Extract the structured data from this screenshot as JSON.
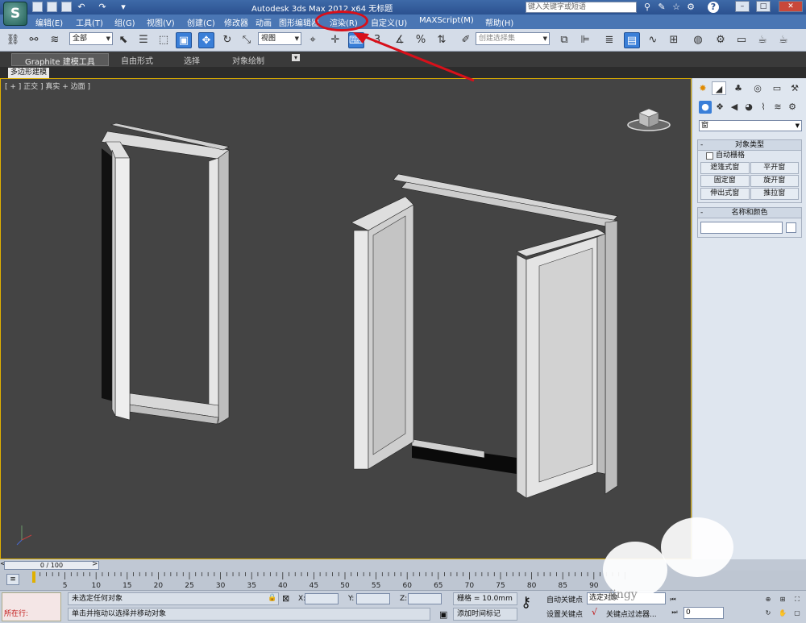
{
  "app": {
    "window_title": "Autodesk 3ds Max  2012 x64      无标题",
    "logo_glyph": "S",
    "search_placeholder": "键入关键字或短语",
    "help_glyph": "?"
  },
  "menu": {
    "items": [
      "编辑(E)",
      "工具(T)",
      "组(G)",
      "视图(V)",
      "创建(C)",
      "修改器",
      "动画",
      "图形编辑器",
      "渲染(R)",
      "自定义(U)",
      "MAXScript(M)",
      "帮助(H)"
    ],
    "highlighted": "渲染(R)"
  },
  "toolbar": {
    "selection_filter": "全部",
    "reference_coord": "视图",
    "named_selection_placeholder": "创建选择集"
  },
  "ribbon": {
    "tabs": [
      "Graphite 建模工具",
      "自由形式",
      "选择",
      "对象绘制"
    ],
    "sub_label": "多边形建模"
  },
  "viewport": {
    "label": "[ + ] 正交 ] 真实 + 边面 ]"
  },
  "command_panel": {
    "category": "窗",
    "object_type": {
      "title": "对象类型",
      "autogrid_label": "自动栅格",
      "buttons": [
        "遮篷式窗",
        "平开窗",
        "固定窗",
        "旋开窗",
        "伸出式窗",
        "推拉窗"
      ]
    },
    "name_color": {
      "title": "名称和颜色"
    }
  },
  "timeline": {
    "frame_display": "0 / 100",
    "ticks": [
      "5",
      "10",
      "15",
      "20",
      "25",
      "30",
      "35",
      "40",
      "45",
      "50",
      "55",
      "60",
      "65",
      "70",
      "75",
      "80",
      "85",
      "90"
    ]
  },
  "status": {
    "maxscript_label": "所在行:",
    "line1": "未选定任何对象",
    "line2": "单击并拖动以选择并移动对象",
    "x_label": "X:",
    "y_label": "Y:",
    "z_label": "Z:",
    "grid": "栅格 = 10.0mm",
    "add_time_tag": "添加时间标记",
    "auto_key": "自动关键点",
    "set_key": "设置关键点",
    "selected_object": "选定对象",
    "key_filters": "关键点过滤器...",
    "frame_value": "0"
  },
  "watermark": "jingy"
}
